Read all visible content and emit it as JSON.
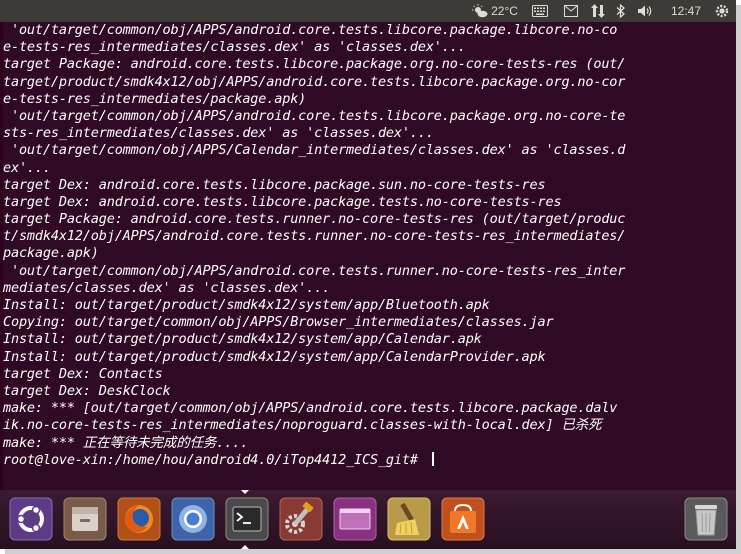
{
  "top_panel": {
    "weather": "22°C",
    "clock": "12:47"
  },
  "terminal": {
    "lines": [
      " 'out/target/common/obj/APPS/android.core.tests.libcore.package.libcore.no-co",
      "e-tests-res_intermediates/classes.dex' as 'classes.dex'...",
      "target Package: android.core.tests.libcore.package.org.no-core-tests-res (out/",
      "target/product/smdk4x12/obj/APPS/android.core.tests.libcore.package.org.no-cor",
      "e-tests-res_intermediates/package.apk)",
      " 'out/target/common/obj/APPS/android.core.tests.libcore.package.org.no-core-te",
      "sts-res_intermediates/classes.dex' as 'classes.dex'...",
      " 'out/target/common/obj/APPS/Calendar_intermediates/classes.dex' as 'classes.d",
      "ex'...",
      "target Dex: android.core.tests.libcore.package.sun.no-core-tests-res",
      "target Dex: android.core.tests.libcore.package.tests.no-core-tests-res",
      "target Package: android.core.tests.runner.no-core-tests-res (out/target/produc",
      "t/smdk4x12/obj/APPS/android.core.tests.runner.no-core-tests-res_intermediates/",
      "package.apk)",
      " 'out/target/common/obj/APPS/android.core.tests.runner.no-core-tests-res_inter",
      "mediates/classes.dex' as 'classes.dex'...",
      "Install: out/target/product/smdk4x12/system/app/Bluetooth.apk",
      "Copying: out/target/common/obj/APPS/Browser_intermediates/classes.jar",
      "Install: out/target/product/smdk4x12/system/app/Calendar.apk",
      "Install: out/target/product/smdk4x12/system/app/CalendarProvider.apk",
      "target Dex: Contacts",
      "target Dex: DeskClock",
      "make: *** [out/target/common/obj/APPS/android.core.tests.libcore.package.dalv",
      "ik.no-core-tests-res_intermediates/noproguard.classes-with-local.dex] 已杀死",
      "make: *** 正在等待未完成的任务....",
      "root@love-xin:/home/hou/android4.0/iTop4412_ICS_git# "
    ]
  },
  "dock": {
    "items": [
      {
        "name": "ubuntu-dash-icon",
        "color": "#6b4a8c"
      },
      {
        "name": "files-icon",
        "color": "#8a6a55"
      },
      {
        "name": "firefox-icon",
        "color": "#c05a1a"
      },
      {
        "name": "chromium-icon",
        "color": "#3f6fb5"
      },
      {
        "name": "terminal-icon",
        "color": "#4a4a4a",
        "active": true
      },
      {
        "name": "system-settings-icon",
        "color": "#a04a3a"
      },
      {
        "name": "workspace-switcher-icon",
        "color": "#9a3a8a"
      },
      {
        "name": "bleachbit-icon",
        "color": "#c6a850"
      },
      {
        "name": "software-center-icon",
        "color": "#d8632b"
      },
      {
        "name": "trash-icon",
        "color": "#5a5a5a"
      }
    ]
  }
}
